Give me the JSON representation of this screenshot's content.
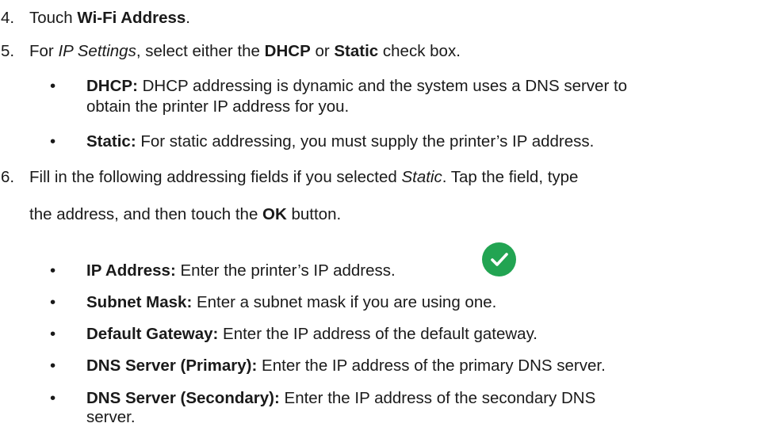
{
  "steps": [
    {
      "number": "4.",
      "parts": [
        {
          "text": "Touch "
        },
        {
          "text": "Wi-Fi Address",
          "style": "bold"
        },
        {
          "text": "."
        }
      ]
    },
    {
      "number": "5.",
      "parts": [
        {
          "text": "For "
        },
        {
          "text": "IP Settings",
          "style": "italic"
        },
        {
          "text": ", select either the "
        },
        {
          "text": "DHCP",
          "style": "bold"
        },
        {
          "text": " or "
        },
        {
          "text": "Static",
          "style": "bold"
        },
        {
          "text": " check box."
        }
      ],
      "bullets": [
        {
          "term": "DHCP:",
          "lines": [
            "DHCP addressing is dynamic and the system uses a DNS server to",
            "obtain the printer IP address for you."
          ]
        },
        {
          "term": "Static:",
          "lines": [
            "For static addressing, you must supply the printer’s IP address."
          ]
        }
      ]
    },
    {
      "number": "6.",
      "line1": [
        {
          "text": "Fill in the following addressing fields if you selected "
        },
        {
          "text": "Static",
          "style": "italic"
        },
        {
          "text": ". Tap the field, type"
        }
      ],
      "line2": [
        {
          "text": "the address, and then touch the "
        },
        {
          "text": "OK",
          "style": "bold"
        },
        {
          "text": " button."
        }
      ],
      "ok_icon": "check-circle-icon",
      "ok_icon_color": "#22a452",
      "bullets": [
        {
          "term": "IP Address:",
          "lines": [
            "Enter the printer’s IP address."
          ]
        },
        {
          "term": "Subnet Mask:",
          "lines": [
            "Enter a subnet mask if you are using one."
          ]
        },
        {
          "term": "Default Gateway:",
          "lines": [
            "Enter the IP address of the default gateway."
          ]
        },
        {
          "term": "DNS Server (Primary):",
          "lines": [
            "Enter the IP address of the primary DNS server."
          ]
        },
        {
          "term": "DNS Server (Secondary):",
          "lines": [
            "Enter the IP address of the secondary DNS",
            "server."
          ]
        }
      ]
    }
  ],
  "bullet_glyph": "•"
}
